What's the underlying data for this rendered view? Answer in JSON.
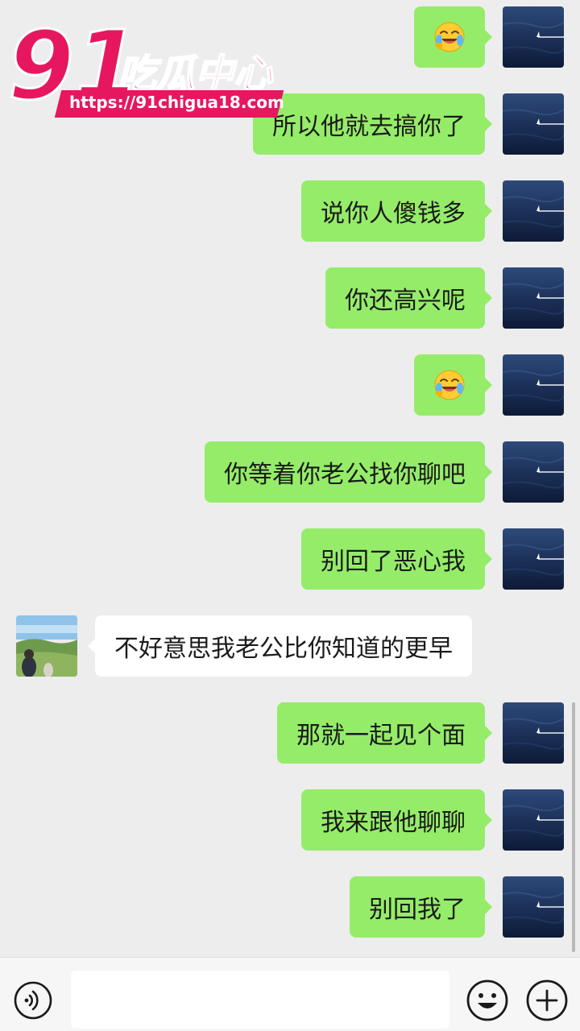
{
  "watermark": {
    "logo_number": "91",
    "logo_text": "吃瓜中心",
    "url": "https://91chigua18.com"
  },
  "colors": {
    "outgoing_bubble": "#95ec69",
    "incoming_bubble": "#ffffff",
    "background": "#ededed",
    "watermark_accent": "#e7175f"
  },
  "messages": [
    {
      "side": "right",
      "type": "emoji",
      "emoji": "laughing-crying-face"
    },
    {
      "side": "right",
      "type": "text",
      "text": "所以他就去搞你了"
    },
    {
      "side": "right",
      "type": "text",
      "text": "说你人傻钱多"
    },
    {
      "side": "right",
      "type": "text",
      "text": "你还高兴呢"
    },
    {
      "side": "right",
      "type": "emoji",
      "emoji": "laughing-crying-face"
    },
    {
      "side": "right",
      "type": "text",
      "text": "你等着你老公找你聊吧"
    },
    {
      "side": "right",
      "type": "text",
      "text": "别回了恶心我"
    },
    {
      "side": "left",
      "type": "text",
      "text": "不好意思我老公比你知道的更早"
    },
    {
      "side": "right",
      "type": "text",
      "text": "那就一起见个面"
    },
    {
      "side": "right",
      "type": "text",
      "text": "我来跟他聊聊"
    },
    {
      "side": "right",
      "type": "text",
      "text": "别回我了"
    }
  ],
  "input_bar": {
    "text_value": "",
    "icons": [
      "voice-icon",
      "emoji-icon",
      "plus-icon"
    ]
  }
}
